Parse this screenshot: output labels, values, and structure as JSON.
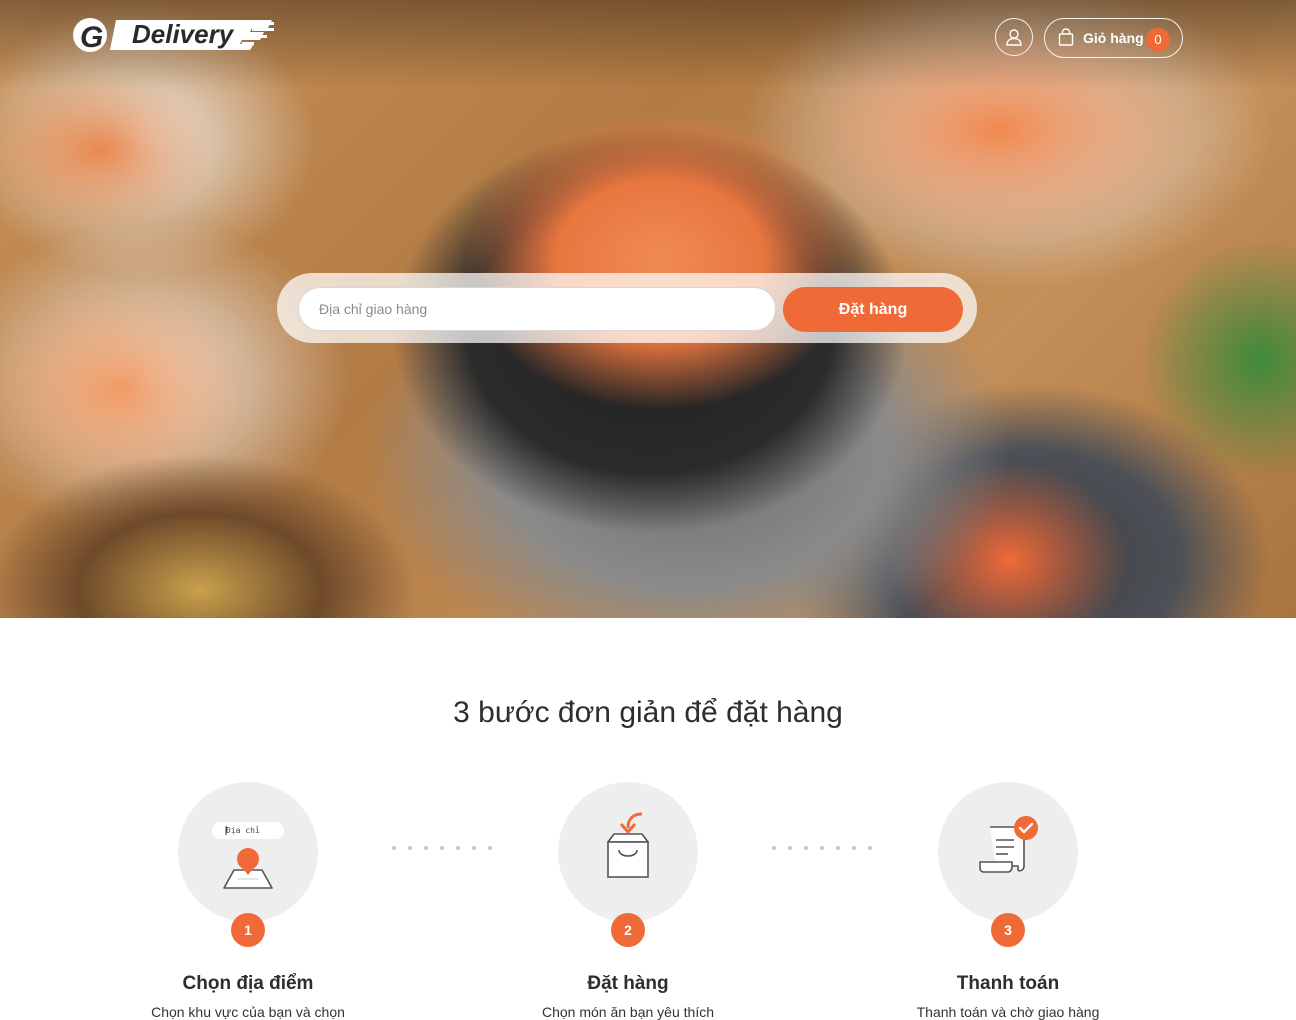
{
  "header": {
    "logo_text": "Delivery",
    "cart_label": "Giỏ hàng",
    "cart_count": "0"
  },
  "search": {
    "placeholder": "Địa chỉ giao hàng",
    "value": "",
    "order_button": "Đặt hàng"
  },
  "steps_section": {
    "title": "3 bước đơn giản để đặt hàng",
    "steps": [
      {
        "number": "1",
        "title": "Chọn địa điểm",
        "description": "Chọn khu vực của bạn và chọn",
        "icon": "map-pin-icon",
        "icon_label": "Địa chỉ"
      },
      {
        "number": "2",
        "title": "Đặt hàng",
        "description": "Chọn món ăn bạn yêu thích",
        "icon": "shopping-bag-icon"
      },
      {
        "number": "3",
        "title": "Thanh toán",
        "description": "Thanh toán và chờ giao hàng",
        "icon": "receipt-check-icon"
      }
    ]
  },
  "colors": {
    "accent": "#ef6a36",
    "circle_bg": "#eeeeee",
    "text_dark": "#2e2e2e"
  }
}
